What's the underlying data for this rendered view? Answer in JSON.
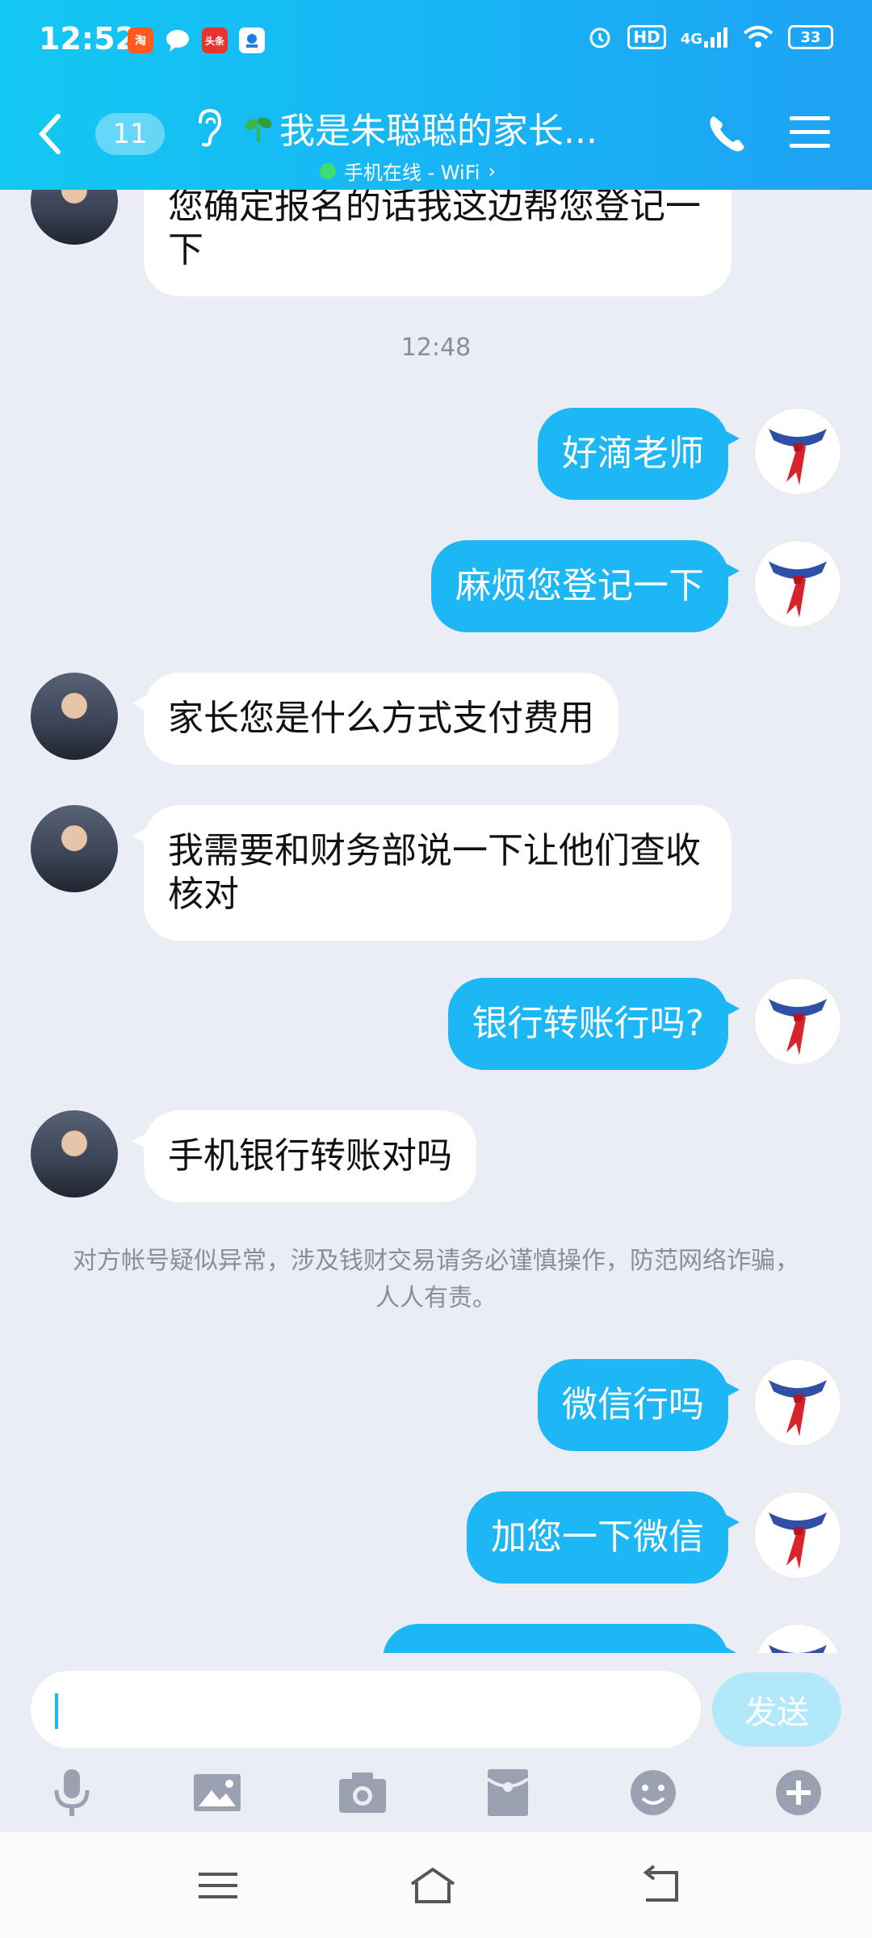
{
  "status_bar": {
    "time": "12:52",
    "apps": [
      "taobao-icon",
      "message-icon",
      "toutiao-icon",
      "tool-app-icon"
    ],
    "hd": "HD",
    "network": "4G",
    "battery": "33"
  },
  "header": {
    "unread_count": "11",
    "title": "我是朱聪聪的家长...",
    "status": "手机在线 - WiFi",
    "status_color": "#3fdc6f"
  },
  "messages": [
    {
      "side": "in",
      "text": "您确定报名的话我这边帮您登记一下"
    },
    {
      "type": "time",
      "text": "12:48"
    },
    {
      "side": "out",
      "text": "好滴老师"
    },
    {
      "side": "out",
      "text": "麻烦您登记一下"
    },
    {
      "side": "in",
      "text": "家长您是什么方式支付费用"
    },
    {
      "side": "in",
      "text": "我需要和财务部说一下让他们查收核对"
    },
    {
      "side": "out",
      "text": "银行转账行吗?"
    },
    {
      "side": "in",
      "text": "手机银行转账对吗"
    },
    {
      "type": "notice",
      "text": "对方帐号疑似异常，涉及钱财交易请务必谨慎操作，防范网络诈骗，人人有责。"
    },
    {
      "side": "out",
      "text": "微信行吗"
    },
    {
      "side": "out",
      "text": "加您一下微信"
    }
  ],
  "input": {
    "placeholder": "",
    "send_label": "发送"
  },
  "toolbar": [
    "microphone-icon",
    "image-icon",
    "camera-icon",
    "red-packet-icon",
    "emoji-icon",
    "plus-icon"
  ],
  "colors": {
    "header_start": "#13c8f2",
    "header_end": "#1ea2f3",
    "outgoing_bubble": "#1eb7f5",
    "incoming_bubble": "#ffffff",
    "chat_background": "#ebedf5"
  }
}
